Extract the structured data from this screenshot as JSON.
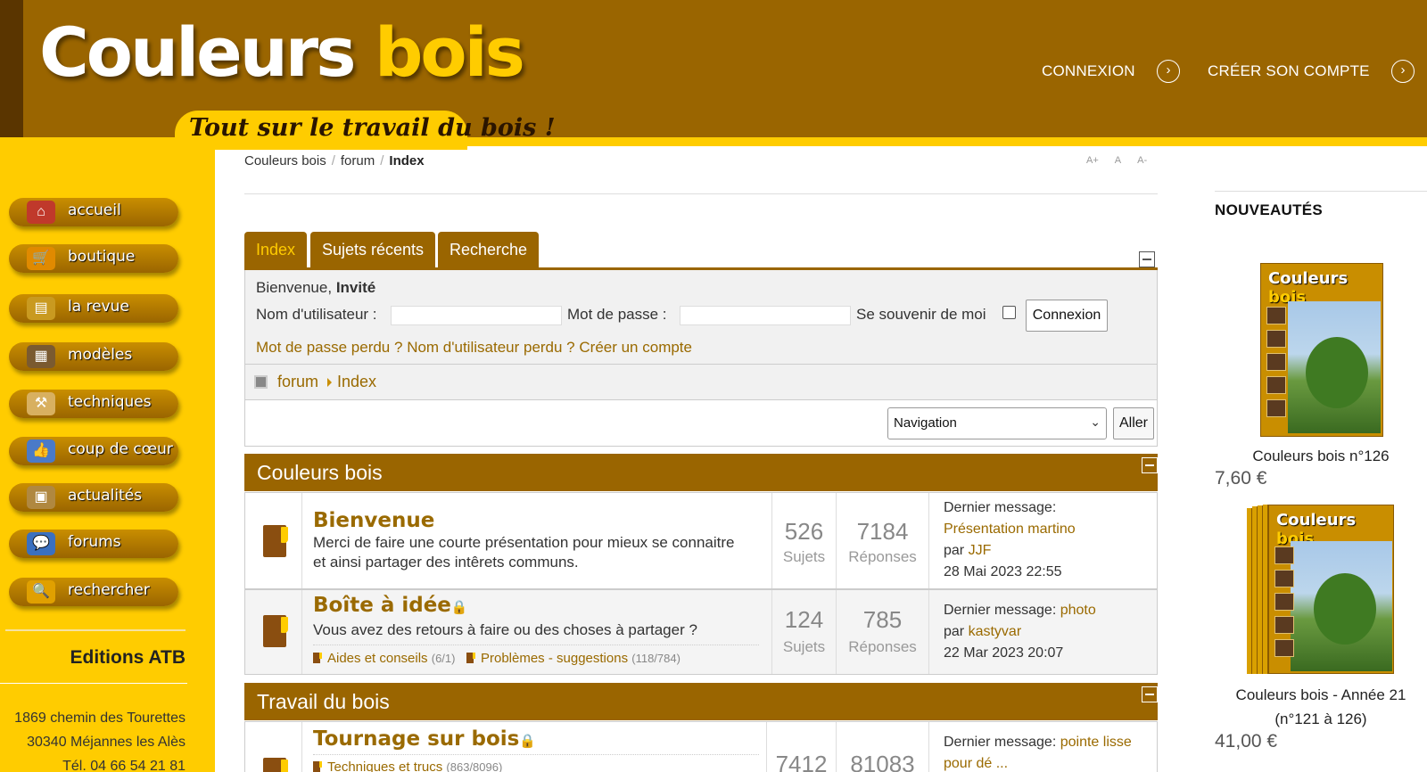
{
  "header": {
    "logo_main": "Couleurs",
    "logo_accent": "bois",
    "tagline": "Tout sur le travail du bois !",
    "connexion": "CONNEXION",
    "create_account": "CRÉER SON COMPTE"
  },
  "sidebar": {
    "items": [
      {
        "label": "accueil",
        "icon": "home-icon"
      },
      {
        "label": "boutique",
        "icon": "cart-icon"
      },
      {
        "label": "la revue",
        "icon": "magazine-icon"
      },
      {
        "label": "modèles",
        "icon": "grid-icon"
      },
      {
        "label": "techniques",
        "icon": "saw-icon"
      },
      {
        "label": "coup de cœur",
        "icon": "thumbs-up-icon"
      },
      {
        "label": "actualités",
        "icon": "news-icon"
      },
      {
        "label": "forums",
        "icon": "speech-bubble-icon"
      },
      {
        "label": "rechercher",
        "icon": "magnifier-icon"
      }
    ],
    "editions_title": "Editions ATB",
    "address_line1": "1869 chemin des Tourettes",
    "address_line2": "30340 Méjannes les Alès",
    "phone": "Tél. 04 66 54 21 81"
  },
  "breadcrumb": {
    "home": "Couleurs bois",
    "forum": "forum",
    "current": "Index"
  },
  "font_tools": {
    "bigger": "A+",
    "normal": "A",
    "smaller": "A-"
  },
  "tabs": [
    {
      "label": "Index",
      "active": true
    },
    {
      "label": "Sujets récents",
      "active": false
    },
    {
      "label": "Recherche",
      "active": false
    }
  ],
  "login": {
    "welcome": "Bienvenue,",
    "guest": "Invité",
    "username_label": "Nom d'utilisateur :",
    "password_label": "Mot de passe :",
    "remember_label": "Se souvenir de moi",
    "submit": "Connexion",
    "lost_password": "Mot de passe perdu ?",
    "lost_username": "Nom d'utilisateur perdu ?",
    "create_account": "Créer un compte"
  },
  "path": {
    "forum": "forum",
    "index": "Index"
  },
  "navigation": {
    "selected": "Navigation",
    "go": "Aller"
  },
  "categories": [
    {
      "title": "Couleurs bois",
      "forums": [
        {
          "title": "Bienvenue",
          "locked": false,
          "description": "Merci de faire une courte présentation pour mieux se connaitre et ainsi partager des intêrets communs.",
          "topics": "526",
          "topics_label": "Sujets",
          "replies": "7184",
          "replies_label": "Réponses",
          "last_label": "Dernier message:",
          "last_title": "Présentation martino",
          "last_by": "par",
          "last_user": "JJF",
          "last_date": "28 Mai 2023 22:55"
        },
        {
          "title": "Boîte à idée",
          "locked": true,
          "description": "Vous avez des retours à faire ou des choses à partager ?",
          "subforums": [
            {
              "name": "Aides et conseils",
              "count": "(6/1)"
            },
            {
              "name": "Problèmes - suggestions",
              "count": "(118/784)"
            }
          ],
          "topics": "124",
          "topics_label": "Sujets",
          "replies": "785",
          "replies_label": "Réponses",
          "last_label": "Dernier message:",
          "last_title": "photo",
          "last_by": "par",
          "last_user": "kastyvar",
          "last_date": "22 Mar 2023 20:07"
        }
      ]
    },
    {
      "title": "Travail du bois",
      "forums": [
        {
          "title": "Tournage sur bois",
          "locked": true,
          "subforums": [
            {
              "name": "Techniques et trucs",
              "count": "(863/8096)"
            }
          ],
          "topics": "7412",
          "replies": "81083",
          "last_label": "Dernier message:",
          "last_title": "pointe lisse",
          "last_title_cont": "pour dé ..."
        }
      ]
    }
  ],
  "right": {
    "title": "NOUVEAUTÉS",
    "products": [
      {
        "name": "Couleurs bois n°126",
        "price": "7,60 €"
      },
      {
        "name_line1": "Couleurs bois - Année 21",
        "name_line2": "(n°121 à 126)",
        "price": "41,00 €"
      }
    ],
    "cover_title_main": "Couleurs",
    "cover_title_accent": "bois"
  },
  "colors": {
    "brand_brown": "#9a6500",
    "brand_yellow": "#ffcc00",
    "link": "#9a6a00"
  }
}
